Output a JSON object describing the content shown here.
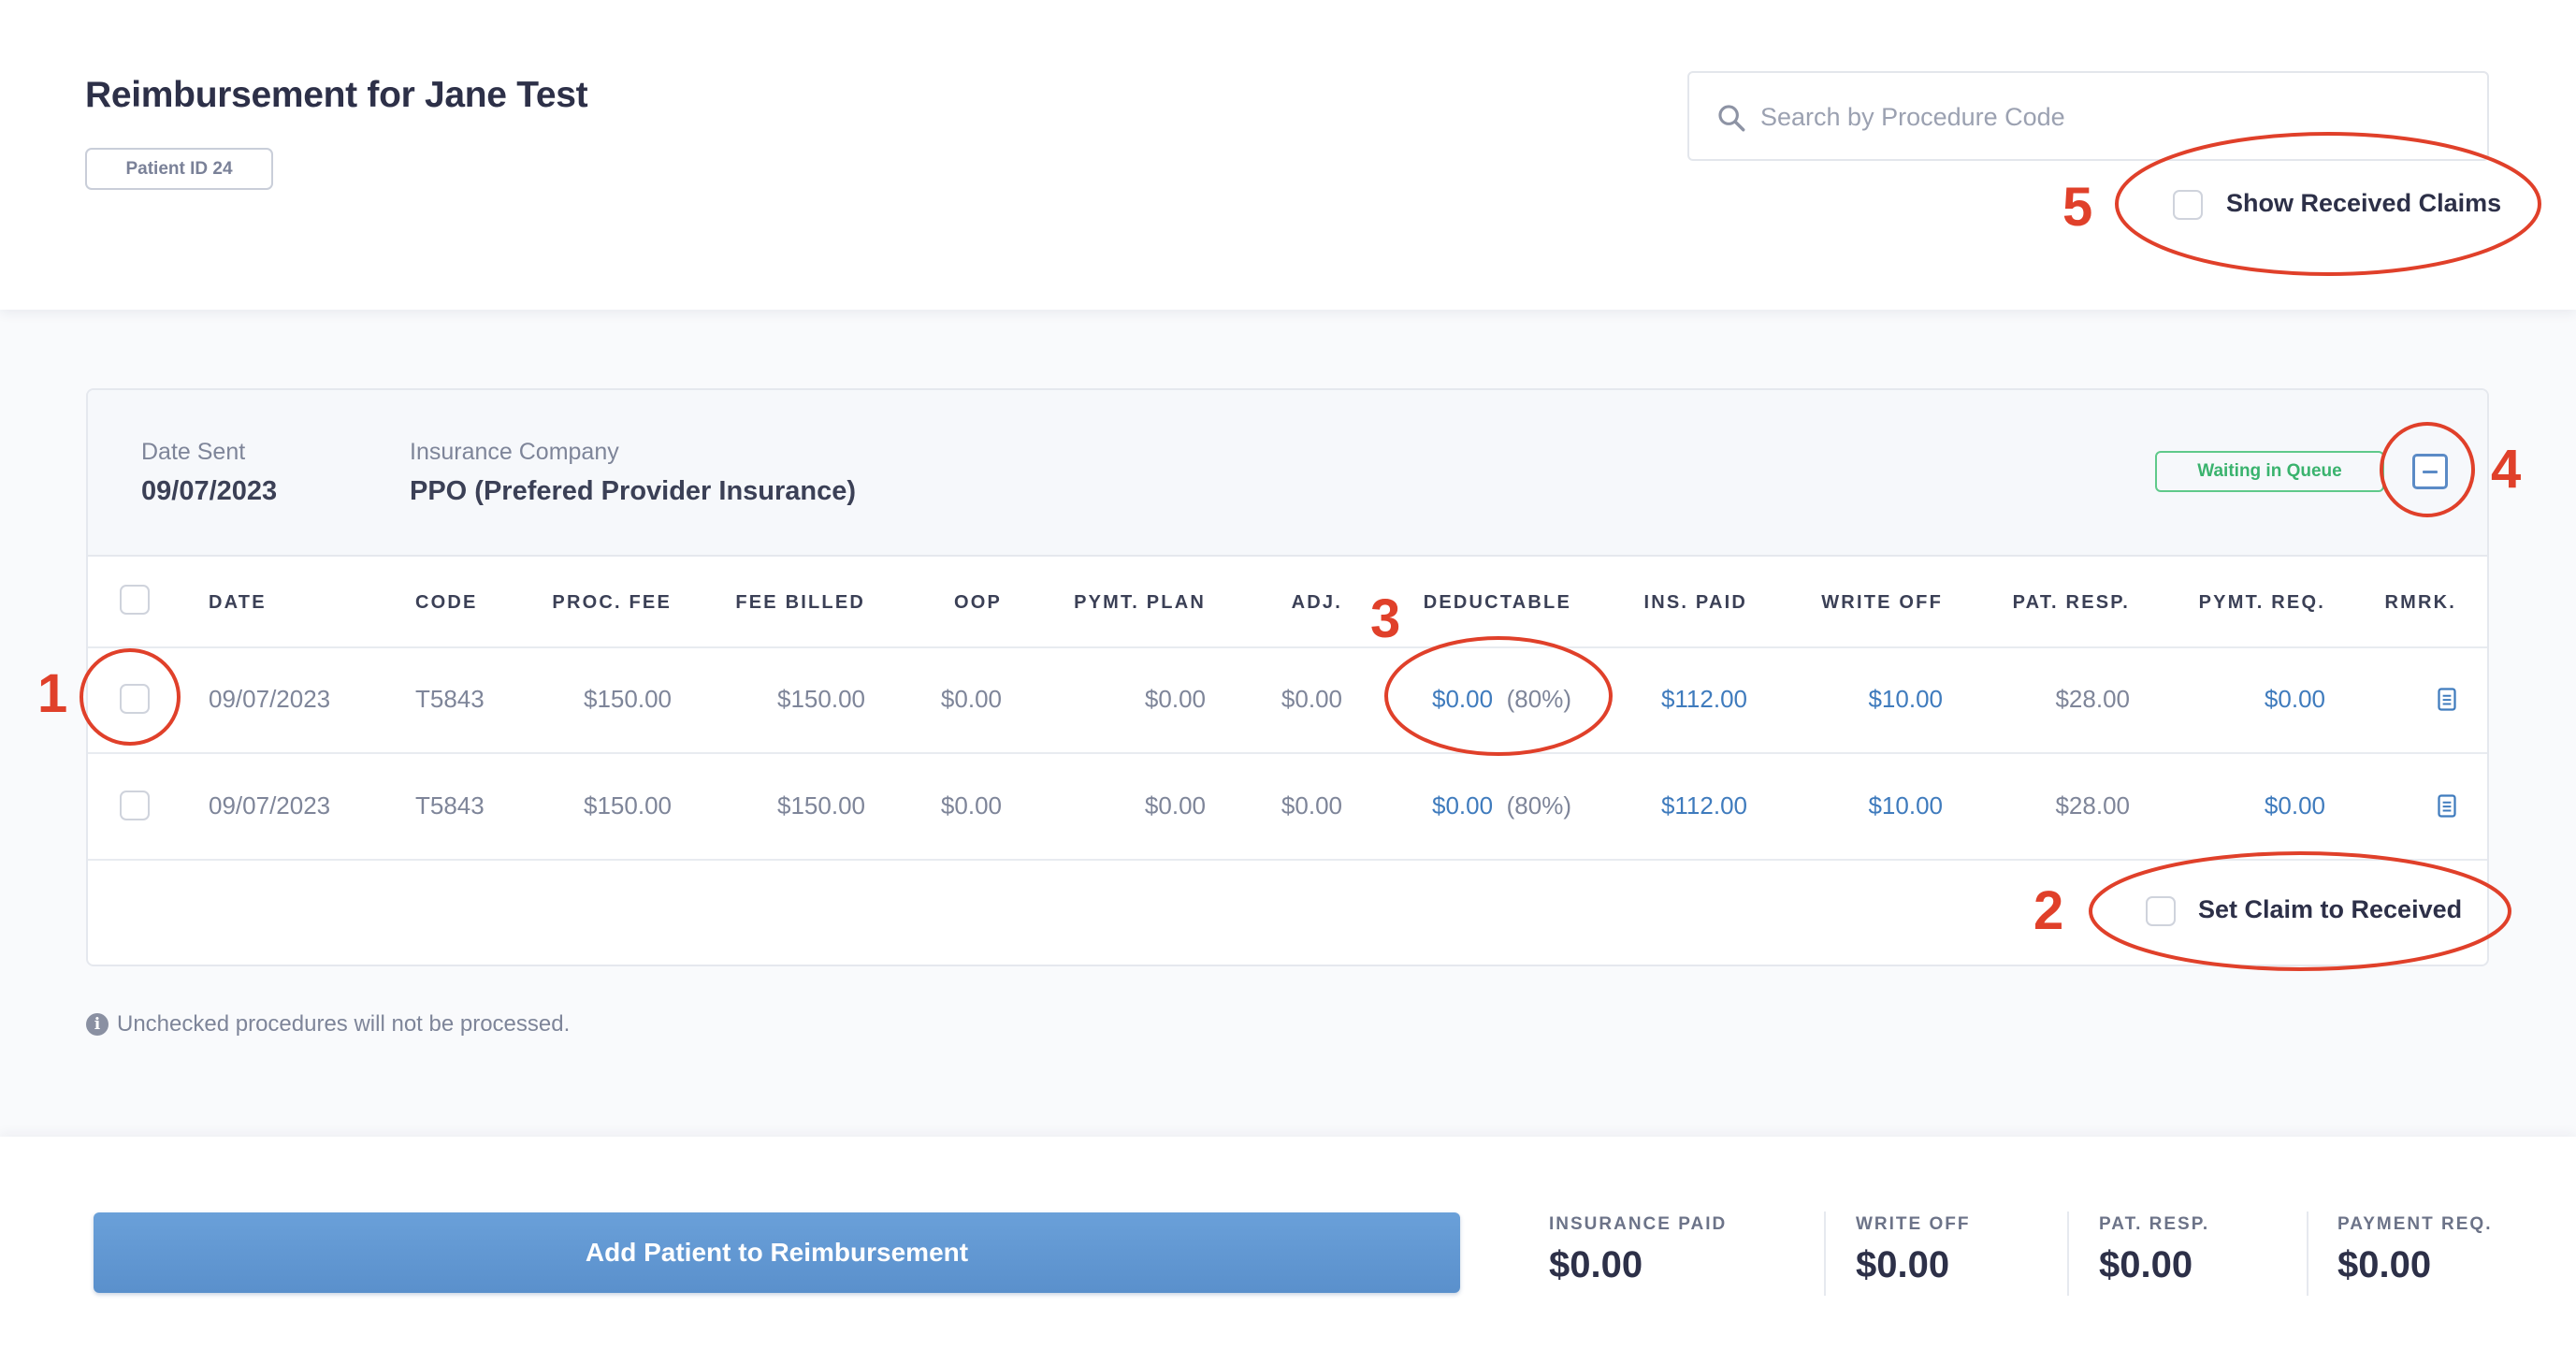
{
  "header": {
    "title": "Reimbursement for Jane Test",
    "patient_badge": "Patient ID 24",
    "search_placeholder": "Search by Procedure Code",
    "show_received_label": "Show Received Claims"
  },
  "claim": {
    "date_sent_label": "Date Sent",
    "date_sent": "09/07/2023",
    "insurance_label": "Insurance Company",
    "insurance": "PPO (Prefered Provider Insurance)",
    "status": "Waiting in Queue",
    "columns": [
      "DATE",
      "CODE",
      "PROC. FEE",
      "FEE BILLED",
      "OOP",
      "PYMT. PLAN",
      "ADJ.",
      "DEDUCTABLE",
      "INS. PAID",
      "WRITE OFF",
      "PAT. RESP.",
      "PYMT. REQ.",
      "RMRK."
    ],
    "rows": [
      {
        "date": "09/07/2023",
        "code": "T5843",
        "proc_fee": "$150.00",
        "fee_billed": "$150.00",
        "oop": "$0.00",
        "pymt_plan": "$0.00",
        "adj": "$0.00",
        "deductable": "$0.00",
        "deductable_pct": "(80%)",
        "ins_paid": "$112.00",
        "write_off": "$10.00",
        "pat_resp": "$28.00",
        "pymt_req": "$0.00"
      },
      {
        "date": "09/07/2023",
        "code": "T5843",
        "proc_fee": "$150.00",
        "fee_billed": "$150.00",
        "oop": "$0.00",
        "pymt_plan": "$0.00",
        "adj": "$0.00",
        "deductable": "$0.00",
        "deductable_pct": "(80%)",
        "ins_paid": "$112.00",
        "write_off": "$10.00",
        "pat_resp": "$28.00",
        "pymt_req": "$0.00"
      }
    ],
    "set_received_label": "Set Claim to Received"
  },
  "note": "Unchecked procedures will not be processed.",
  "footer": {
    "button_label": "Add Patient to Reimbursement",
    "summary": [
      {
        "label": "INSURANCE PAID",
        "value": "$0.00"
      },
      {
        "label": "WRITE OFF",
        "value": "$0.00"
      },
      {
        "label": "PAT. RESP.",
        "value": "$0.00"
      },
      {
        "label": "PAYMENT REQ.",
        "value": "$0.00"
      }
    ]
  },
  "annotations": [
    "1",
    "2",
    "3",
    "4",
    "5"
  ],
  "colors": {
    "annotation": "#e0402a",
    "link": "#3f7bbd",
    "status": "#3ab36e",
    "primary": "#5f96d2"
  },
  "icons": {
    "search": "search-icon",
    "collapse": "minus-square-icon",
    "remark": "document-icon",
    "info": "info-icon"
  }
}
